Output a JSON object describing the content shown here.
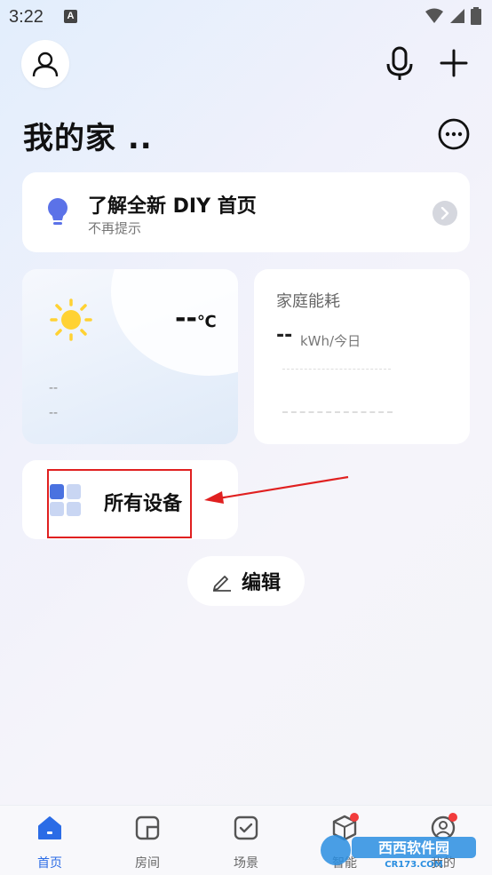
{
  "status_bar": {
    "time": "3:22",
    "notification_letter": "A"
  },
  "header": {
    "title": "我的家 .."
  },
  "tip_card": {
    "title": "了解全新 DIY 首页",
    "subtitle": "不再提示"
  },
  "weather": {
    "temperature": "--",
    "unit": "℃",
    "line1": "--",
    "line2": "--"
  },
  "energy": {
    "title": "家庭能耗",
    "value": "--",
    "unit": "kWh/今日"
  },
  "devices": {
    "label": "所有设备"
  },
  "edit_button": {
    "label": "编辑"
  },
  "tabs": [
    {
      "label": "首页",
      "active": true
    },
    {
      "label": "房间",
      "active": false
    },
    {
      "label": "场景",
      "active": false
    },
    {
      "label": "智能",
      "active": false,
      "badge": true
    },
    {
      "label": "我的",
      "active": false,
      "badge": true
    }
  ],
  "colors": {
    "accent": "#2b6ce6",
    "highlight": "#e02020",
    "badge": "#f23c3c"
  },
  "watermark": {
    "brand": "西西软件园",
    "site": "CR173.COM"
  }
}
